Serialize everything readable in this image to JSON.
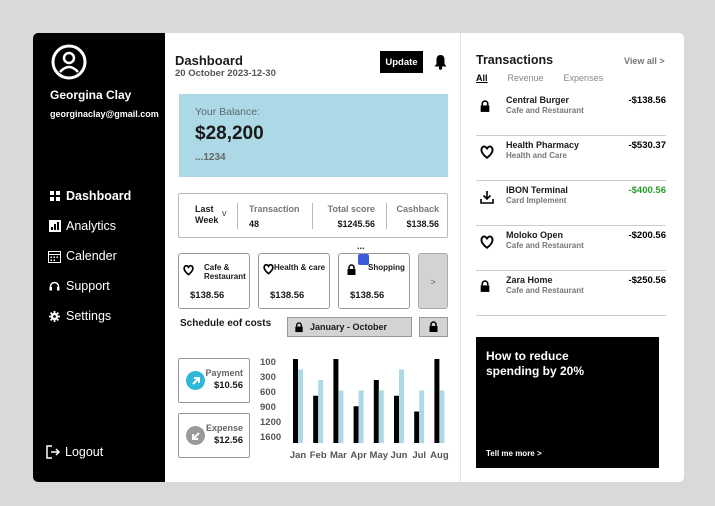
{
  "user": {
    "name": "Georgina Clay",
    "email": "georginaclay@gmail.com"
  },
  "nav": [
    {
      "label": "Dashboard",
      "icon": "grid-icon",
      "active": true
    },
    {
      "label": "Analytics",
      "icon": "bar-chart-icon"
    },
    {
      "label": "Calender",
      "icon": "calendar-icon"
    },
    {
      "label": "Support",
      "icon": "headset-icon"
    },
    {
      "label": "Settings",
      "icon": "gear-icon"
    }
  ],
  "logout_label": "Logout",
  "header": {
    "title": "Dashboard",
    "date": "20 October 2023-12-30",
    "update_label": "Update"
  },
  "balance": {
    "label": "Your Balance:",
    "amount": "$28,200",
    "account": "...1234",
    "color": "#add8e6"
  },
  "stats": {
    "period": "Last Week",
    "period_line1": "Last",
    "period_line2": "Week",
    "chevron": "v",
    "transaction": {
      "label": "Transaction",
      "value": "48"
    },
    "total_score": {
      "label": "Total score",
      "value": "$1245.56"
    },
    "cashback": {
      "label": "Cashback",
      "value": "$138.56"
    }
  },
  "categories": [
    {
      "line1": "Cafe &",
      "line2": "Restaurant",
      "value": "$138.56",
      "icon": "heart-shield-icon"
    },
    {
      "line1": "Health & care",
      "line2": "",
      "value": "$138.56",
      "icon": "heart-shield-icon"
    },
    {
      "line1": "Shopping",
      "line2": "",
      "value": "$138.56",
      "icon": "lock-icon"
    }
  ],
  "more_label": ">",
  "dots": "...",
  "schedule": {
    "title": "Schedule eof costs",
    "range": "January  - October"
  },
  "payment": {
    "label": "Payment",
    "value": "$10.56",
    "color": "#2db7d9"
  },
  "expense": {
    "label": "Expense",
    "value": "$12.56",
    "color": "#9a9a9a"
  },
  "chart_data": {
    "type": "bar",
    "categories": [
      "Jan",
      "Feb",
      "Mar",
      "Apr",
      "May",
      "Jun",
      "Jul",
      "Aug"
    ],
    "y_tick_labels": [
      "100",
      "300",
      "600",
      "900",
      "1200",
      "1600"
    ],
    "series": [
      {
        "values": [
          1600,
          900,
          1600,
          700,
          1200,
          900,
          600,
          1600
        ],
        "color": "#000000"
      },
      {
        "values": [
          1400,
          1200,
          1000,
          1000,
          1000,
          1400,
          1000,
          1000
        ],
        "color": "#add8e6"
      }
    ],
    "ylim": [
      0,
      1600
    ],
    "xlabel": "",
    "ylabel": ""
  },
  "transactions": {
    "title": "Transactions",
    "view_all": "View all >",
    "tabs": [
      "All",
      "Revenue",
      "Expenses"
    ],
    "items": [
      {
        "name": "Central Burger",
        "sub": "Cafe and Restaurant",
        "amount": "-$138.56",
        "icon": "lock-icon",
        "color": "#000000"
      },
      {
        "name": "Health Pharmacy",
        "sub": "Health and Care",
        "amount": "-$530.37",
        "icon": "heart-shield-icon",
        "color": "#000000"
      },
      {
        "name": "IBON Terminal",
        "sub": "Card Implement",
        "amount": "-$400.56",
        "icon": "download-icon",
        "color": "#2a9d2a"
      },
      {
        "name": "Moloko Open",
        "sub": "Cafe and Restaurant",
        "amount": "-$200.56",
        "icon": "heart-shield-icon",
        "color": "#000000"
      },
      {
        "name": "Zara Home",
        "sub": "Cafe and Restaurant",
        "amount": "-$250.56",
        "icon": "lock-icon",
        "color": "#000000"
      }
    ]
  },
  "promo": {
    "title": "How to reduce spending by 20%",
    "more": "Tell me more >"
  }
}
